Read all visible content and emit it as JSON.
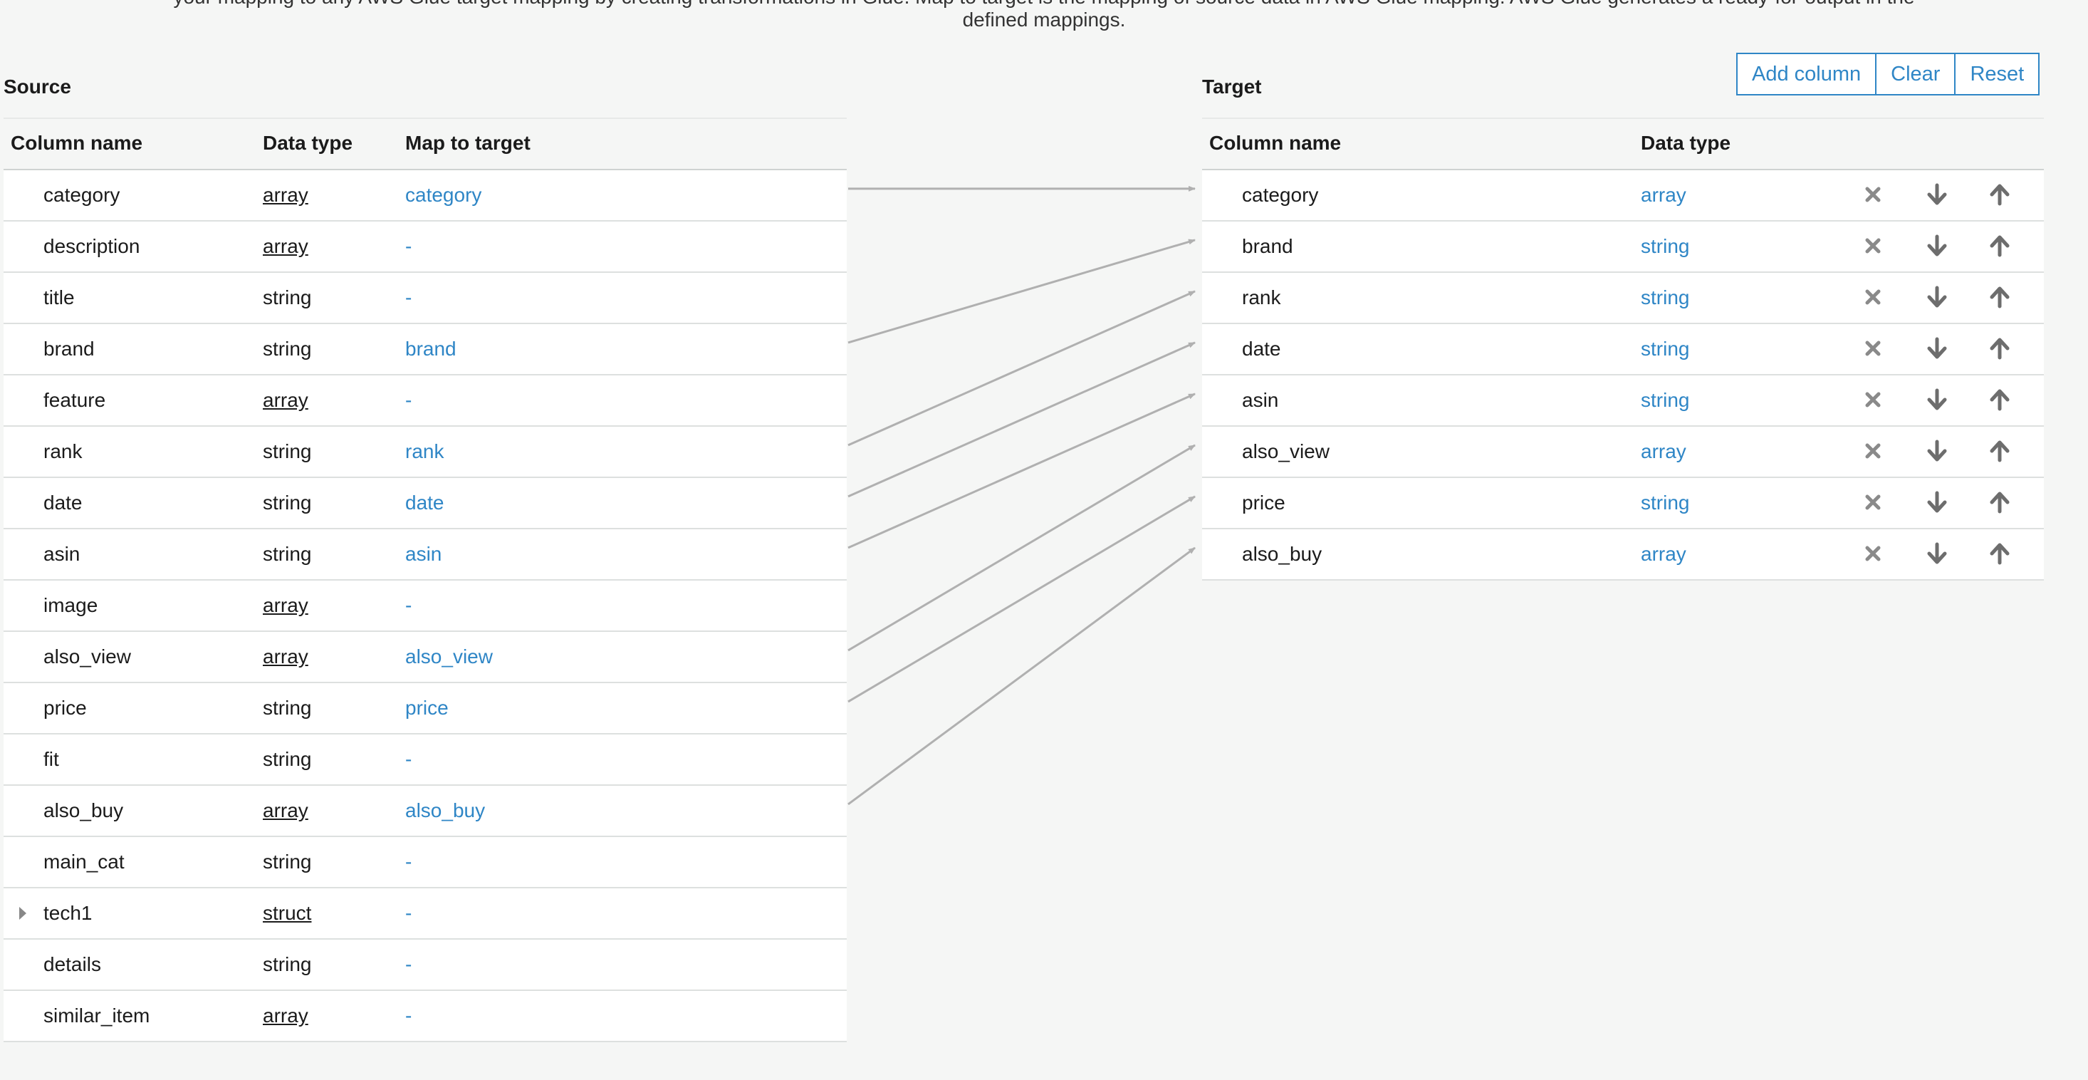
{
  "intro": {
    "line1": "your mapping to any AWS Glue target mapping by creating transformations in Glue. Map to target is the mapping of source data in AWS Glue mapping. AWS Glue generates a ready-for-output in the",
    "line2": "defined mappings."
  },
  "source": {
    "title": "Source",
    "headers": {
      "column_name": "Column name",
      "data_type": "Data type",
      "map_to_target": "Map to target"
    },
    "rows": [
      {
        "name": "category",
        "type": "array",
        "map": "category"
      },
      {
        "name": "description",
        "type": "array",
        "map": "-"
      },
      {
        "name": "title",
        "type": "string",
        "map": "-"
      },
      {
        "name": "brand",
        "type": "string",
        "map": "brand"
      },
      {
        "name": "feature",
        "type": "array",
        "map": "-"
      },
      {
        "name": "rank",
        "type": "string",
        "map": "rank"
      },
      {
        "name": "date",
        "type": "string",
        "map": "date"
      },
      {
        "name": "asin",
        "type": "string",
        "map": "asin"
      },
      {
        "name": "image",
        "type": "array",
        "map": "-"
      },
      {
        "name": "also_view",
        "type": "array",
        "map": "also_view"
      },
      {
        "name": "price",
        "type": "string",
        "map": "price"
      },
      {
        "name": "fit",
        "type": "string",
        "map": "-"
      },
      {
        "name": "also_buy",
        "type": "array",
        "map": "also_buy"
      },
      {
        "name": "main_cat",
        "type": "string",
        "map": "-"
      },
      {
        "name": "tech1",
        "type": "struct",
        "map": "-"
      },
      {
        "name": "details",
        "type": "string",
        "map": "-"
      },
      {
        "name": "similar_item",
        "type": "array",
        "map": "-"
      }
    ]
  },
  "target": {
    "title": "Target",
    "headers": {
      "column_name": "Column name",
      "data_type": "Data type"
    },
    "rows": [
      {
        "name": "category",
        "type": "array"
      },
      {
        "name": "brand",
        "type": "string"
      },
      {
        "name": "rank",
        "type": "string"
      },
      {
        "name": "date",
        "type": "string"
      },
      {
        "name": "asin",
        "type": "string"
      },
      {
        "name": "also_view",
        "type": "array"
      },
      {
        "name": "price",
        "type": "string"
      },
      {
        "name": "also_buy",
        "type": "array"
      }
    ]
  },
  "toolbar": {
    "add_column": "Add column",
    "clear": "Clear",
    "reset": "Reset"
  },
  "icons": {
    "remove": "close-icon",
    "move_down": "arrow-down-icon",
    "move_up": "arrow-up-icon"
  },
  "colors": {
    "accent": "#2f86c6",
    "connector": "#b0b0b0",
    "icon": "#6d6d6d",
    "remove_icon": "#8a8a8a"
  }
}
